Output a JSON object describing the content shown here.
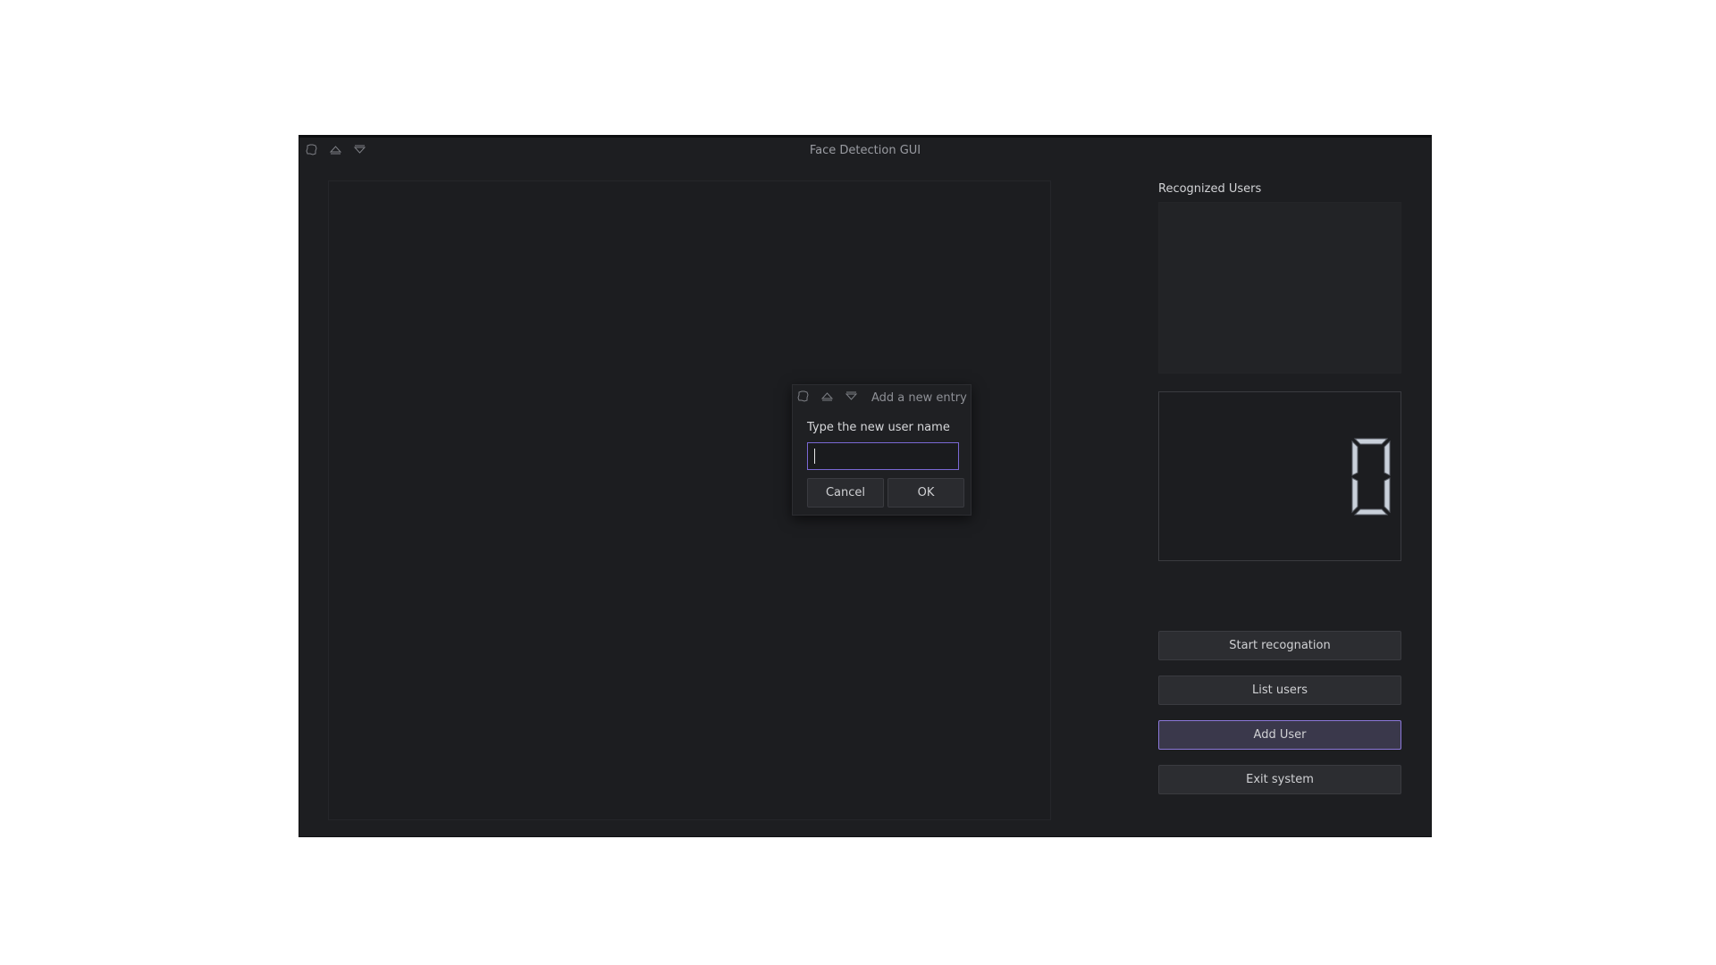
{
  "window": {
    "title": "Face Detection GUI",
    "titlebar_icons": [
      "pin-icon",
      "shade-up-icon",
      "shade-down-icon"
    ]
  },
  "right_panel": {
    "recognized_users_label": "Recognized Users",
    "recognized_users": [],
    "lcd_value": "0"
  },
  "buttons": {
    "start": "Start recognation",
    "list": "List users",
    "add": "Add User",
    "exit": "Exit system"
  },
  "dialog": {
    "title": "Add a new entry",
    "prompt": "Type the new user name",
    "input_value": "",
    "cancel": "Cancel",
    "ok": "OK"
  },
  "colors": {
    "background": "#1d1e21",
    "accent": "#8b78d9",
    "text": "#d0d1d4"
  }
}
